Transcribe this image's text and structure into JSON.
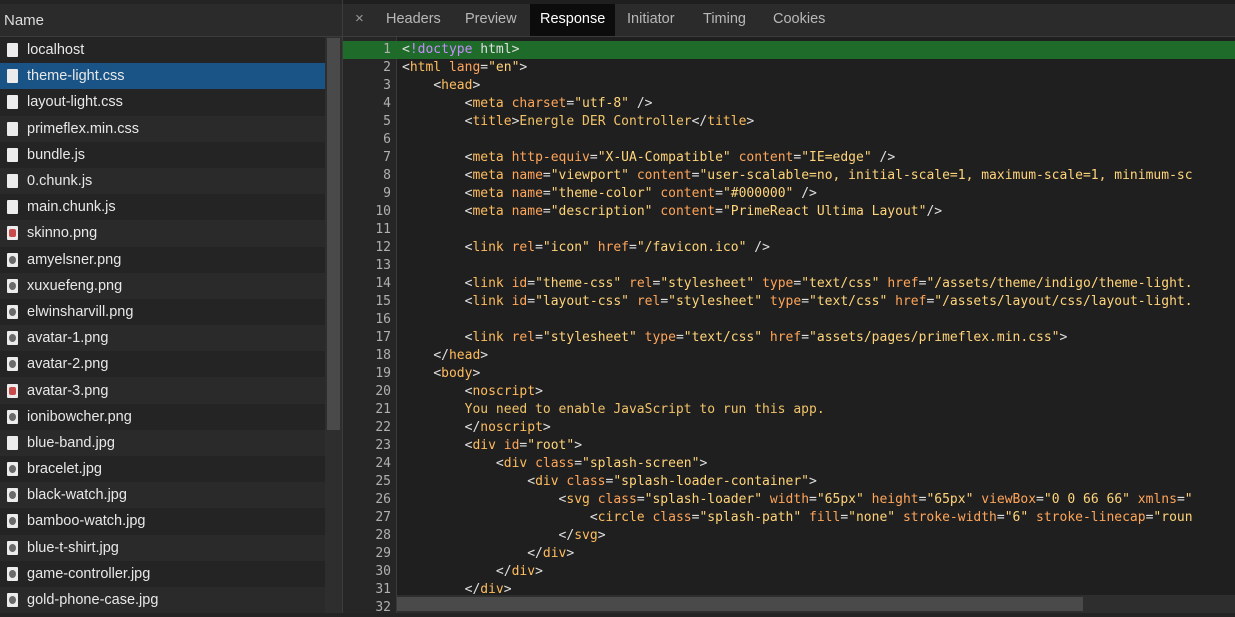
{
  "left": {
    "header": "Name",
    "files": [
      {
        "name": "localhost",
        "type": "doc",
        "selected": false
      },
      {
        "name": "theme-light.css",
        "type": "doc",
        "selected": true
      },
      {
        "name": "layout-light.css",
        "type": "doc",
        "selected": false
      },
      {
        "name": "primeflex.min.css",
        "type": "doc",
        "selected": false
      },
      {
        "name": "bundle.js",
        "type": "doc",
        "selected": false
      },
      {
        "name": "0.chunk.js",
        "type": "doc",
        "selected": false
      },
      {
        "name": "main.chunk.js",
        "type": "doc",
        "selected": false
      },
      {
        "name": "skinno.png",
        "type": "img-red",
        "selected": false
      },
      {
        "name": "amyelsner.png",
        "type": "img",
        "selected": false
      },
      {
        "name": "xuxuefeng.png",
        "type": "img",
        "selected": false
      },
      {
        "name": "elwinsharvill.png",
        "type": "img",
        "selected": false
      },
      {
        "name": "avatar-1.png",
        "type": "img",
        "selected": false
      },
      {
        "name": "avatar-2.png",
        "type": "img",
        "selected": false
      },
      {
        "name": "avatar-3.png",
        "type": "img-red",
        "selected": false
      },
      {
        "name": "ionibowcher.png",
        "type": "img",
        "selected": false
      },
      {
        "name": "blue-band.jpg",
        "type": "doc",
        "selected": false
      },
      {
        "name": "bracelet.jpg",
        "type": "img",
        "selected": false
      },
      {
        "name": "black-watch.jpg",
        "type": "img",
        "selected": false
      },
      {
        "name": "bamboo-watch.jpg",
        "type": "img",
        "selected": false
      },
      {
        "name": "blue-t-shirt.jpg",
        "type": "img",
        "selected": false
      },
      {
        "name": "game-controller.jpg",
        "type": "img",
        "selected": false
      },
      {
        "name": "gold-phone-case.jpg",
        "type": "img",
        "selected": false
      }
    ]
  },
  "tabs": {
    "close": "×",
    "items": [
      "Headers",
      "Preview",
      "Response",
      "Initiator",
      "Timing",
      "Cookies"
    ],
    "active": "Response"
  },
  "code": {
    "lines": [
      "<!doctype html>",
      "<html lang=\"en\">",
      "    <head>",
      "        <meta charset=\"utf-8\" />",
      "        <title>Energle DER Controller</title>",
      "",
      "        <meta http-equiv=\"X-UA-Compatible\" content=\"IE=edge\" />",
      "        <meta name=\"viewport\" content=\"user-scalable=no, initial-scale=1, maximum-scale=1, minimum-sc",
      "        <meta name=\"theme-color\" content=\"#000000\" />",
      "        <meta name=\"description\" content=\"PrimeReact Ultima Layout\"/>",
      "",
      "        <link rel=\"icon\" href=\"/favicon.ico\" />",
      "",
      "        <link id=\"theme-css\" rel=\"stylesheet\" type=\"text/css\" href=\"/assets/theme/indigo/theme-light.",
      "        <link id=\"layout-css\" rel=\"stylesheet\" type=\"text/css\" href=\"/assets/layout/css/layout-light.",
      "",
      "        <link rel=\"stylesheet\" type=\"text/css\" href=\"assets/pages/primeflex.min.css\">",
      "    </head>",
      "    <body>",
      "        <noscript>",
      "        You need to enable JavaScript to run this app.",
      "        </noscript>",
      "        <div id=\"root\">",
      "            <div class=\"splash-screen\">",
      "                <div class=\"splash-loader-container\">",
      "                    <svg class=\"splash-loader\" width=\"65px\" height=\"65px\" viewBox=\"0 0 66 66\" xmlns=\"",
      "                        <circle class=\"splash-path\" fill=\"none\" stroke-width=\"6\" stroke-linecap=\"roun",
      "                    </svg>",
      "                </div>",
      "            </div>",
      "        </div>",
      ""
    ],
    "highlighted_line": 1
  }
}
